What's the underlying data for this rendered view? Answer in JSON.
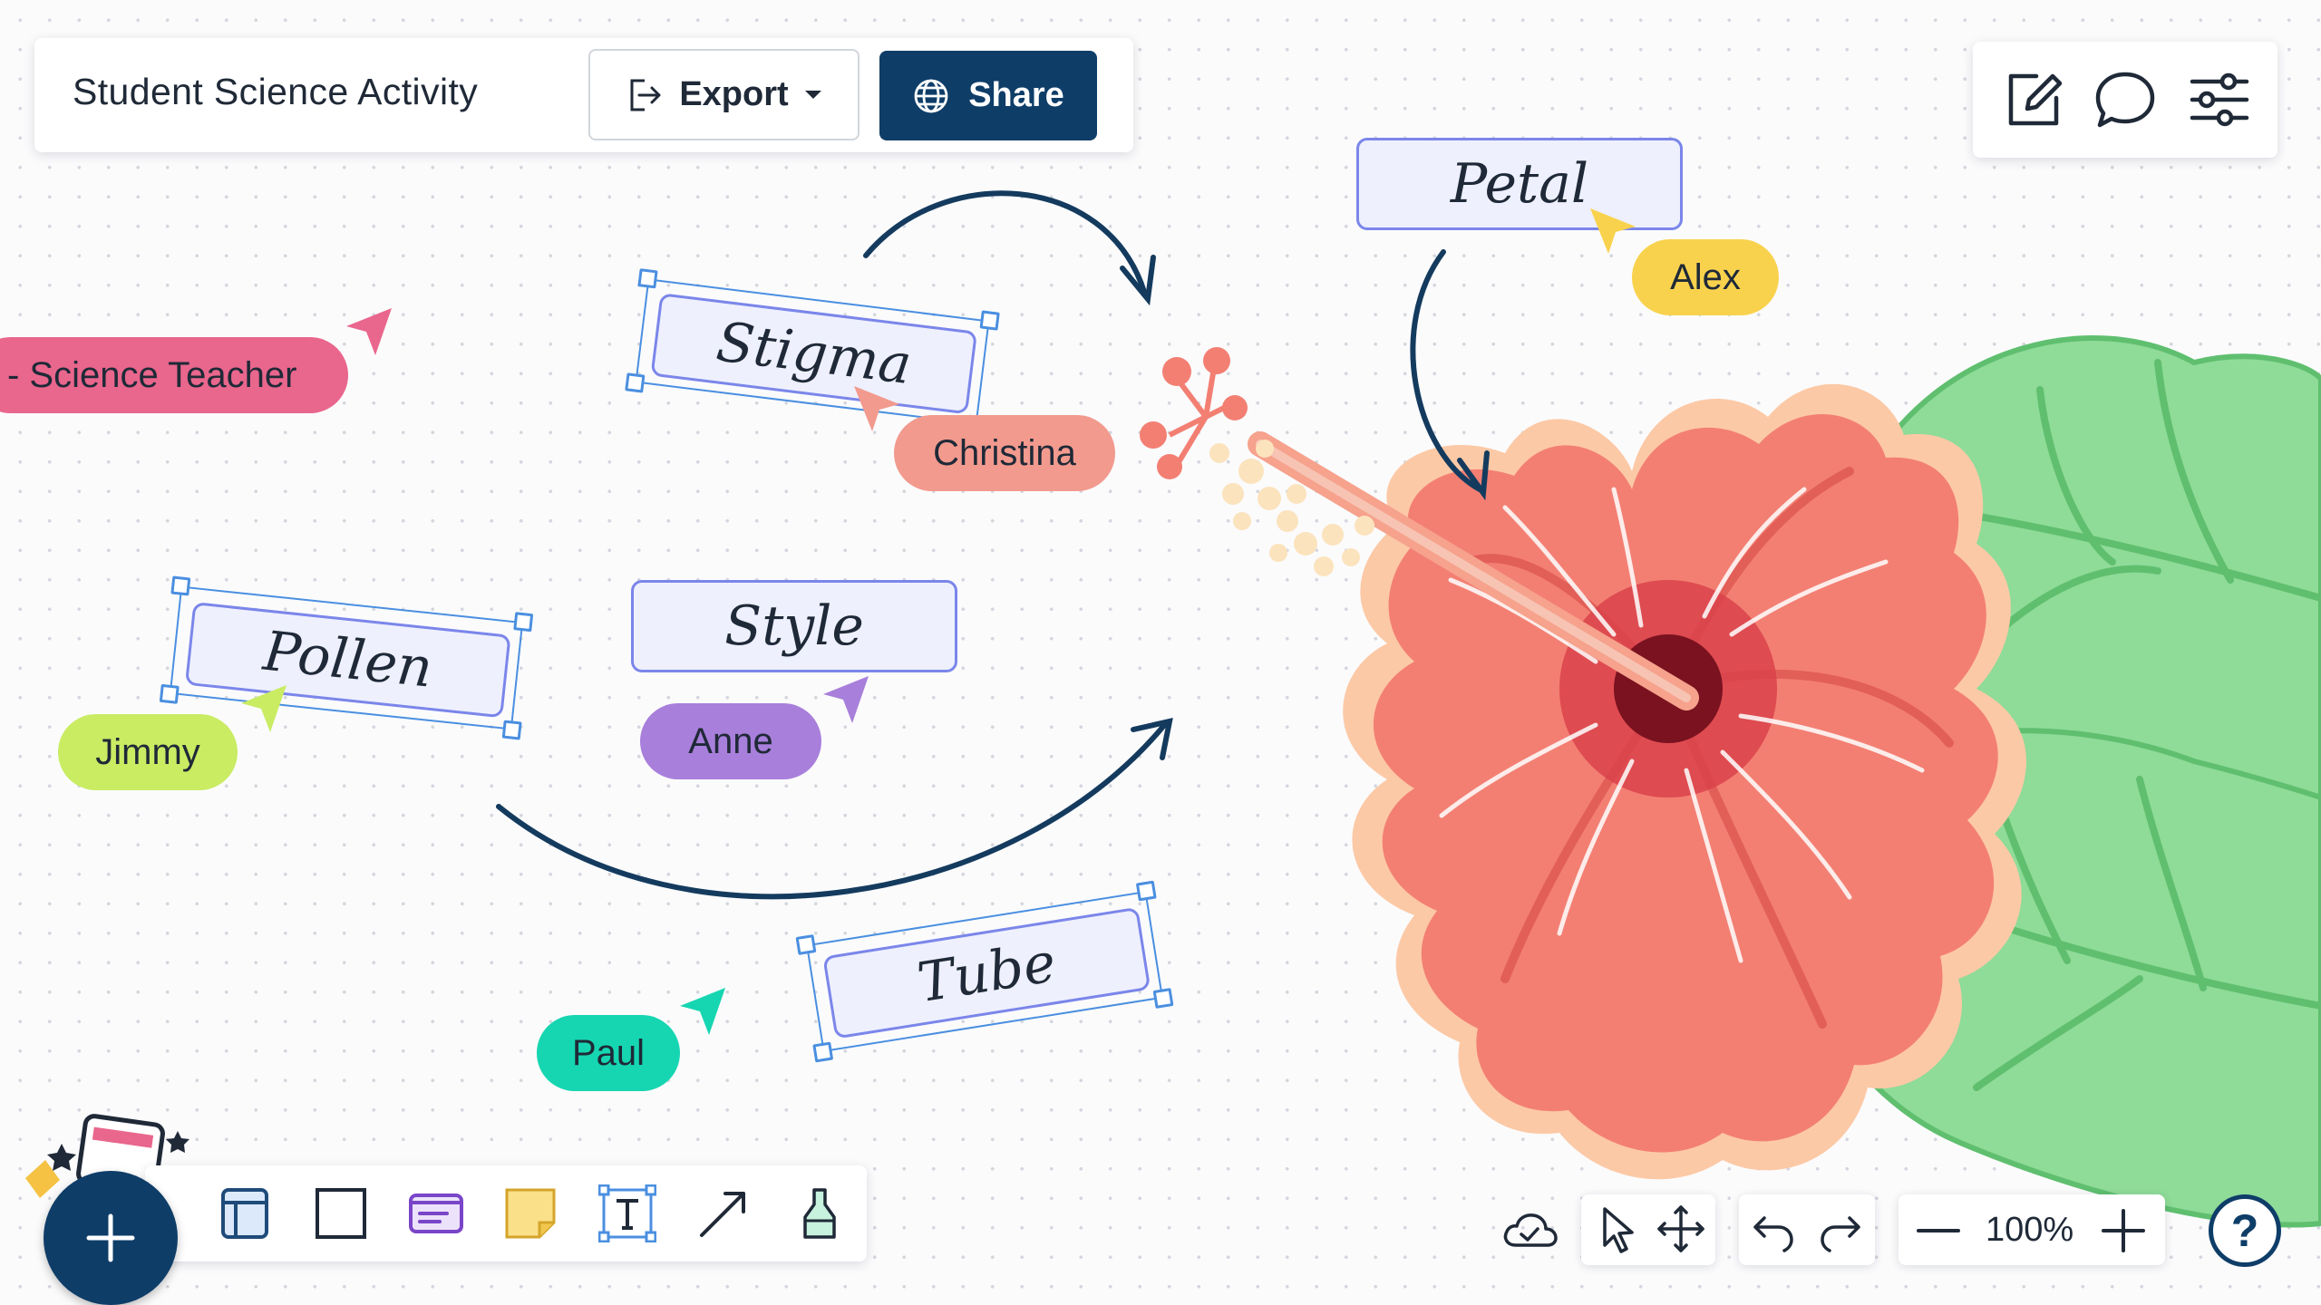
{
  "header": {
    "doc_title": "Student Science Activity",
    "export_label": "Export",
    "share_label": "Share"
  },
  "top_right_icons": [
    "edit-note-icon",
    "comment-icon",
    "settings-sliders-icon"
  ],
  "canvas": {
    "labels": {
      "petal": "Petal",
      "stigma": "Stigma",
      "style": "Style",
      "pollen": "Pollen",
      "tube": "Tube"
    },
    "users": {
      "teacher": "- Science Teacher",
      "alex": "Alex",
      "christina": "Christina",
      "jimmy": "Jimmy",
      "anne": "Anne",
      "paul": "Paul"
    },
    "colors": {
      "teacher": "#e9668c",
      "alex": "#f9d24d",
      "christina": "#f29a8e",
      "jimmy": "#c9ec63",
      "anne": "#a87fdb",
      "paul": "#16d6b1",
      "label_border": "#7b86ea",
      "accent": "#0e3d68"
    }
  },
  "toolbar": {
    "tools": [
      "frame-tool-icon",
      "rectangle-tool-icon",
      "card-tool-icon",
      "sticky-note-tool-icon",
      "text-tool-icon",
      "arrow-tool-icon",
      "pen-tool-icon"
    ]
  },
  "bottom_controls": {
    "zoom_level": "100%",
    "help": "?"
  }
}
